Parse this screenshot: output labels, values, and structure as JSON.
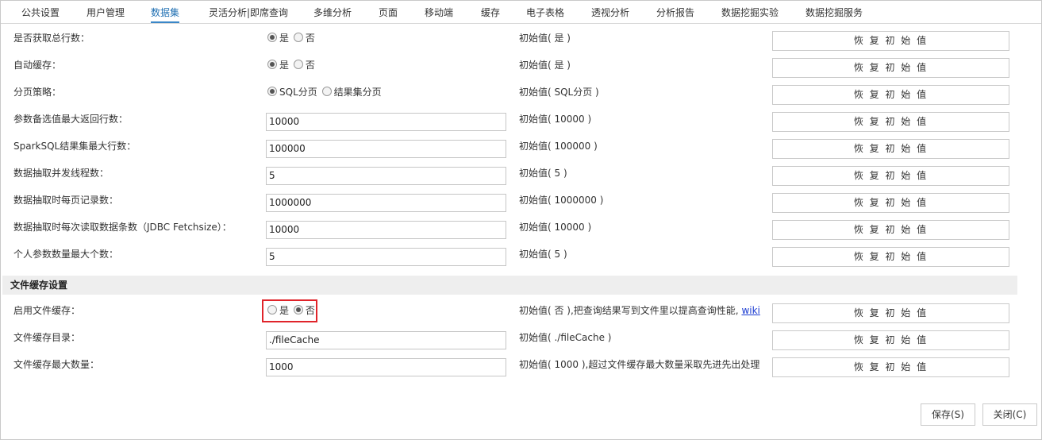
{
  "tabs": [
    {
      "label": "公共设置"
    },
    {
      "label": "用户管理"
    },
    {
      "label": "数据集"
    },
    {
      "label": "灵活分析|即席查询"
    },
    {
      "label": "多维分析"
    },
    {
      "label": "页面"
    },
    {
      "label": "移动端"
    },
    {
      "label": "缓存"
    },
    {
      "label": "电子表格"
    },
    {
      "label": "透视分析"
    },
    {
      "label": "分析报告"
    },
    {
      "label": "数据挖掘实验"
    },
    {
      "label": "数据挖掘服务"
    }
  ],
  "active_tab": "数据集",
  "reset_label": "恢 复 初 始 值",
  "radio": {
    "yes": "是",
    "no": "否",
    "sql_paging": "SQL分页",
    "resultset_paging": "结果集分页"
  },
  "rows": {
    "get_total_rows": {
      "label": "是否获取总行数：",
      "selected": "是",
      "initial": "初始值( 是 )"
    },
    "auto_cache": {
      "label": "自动缓存：",
      "selected": "是",
      "initial": "初始值( 是 )"
    },
    "paging_strategy": {
      "label": "分页策略：",
      "selected": "SQL分页",
      "initial": "初始值( SQL分页 )"
    },
    "param_max_rows": {
      "label": "参数备选值最大返回行数：",
      "value": "10000",
      "initial": "初始值( 10000 )"
    },
    "sparksql_max_rows": {
      "label": "SparkSQL结果集最大行数：",
      "value": "100000",
      "initial": "初始值( 100000 )"
    },
    "extract_threads": {
      "label": "数据抽取并发线程数：",
      "value": "5",
      "initial": "初始值( 5 )"
    },
    "extract_page_records": {
      "label": "数据抽取时每页记录数：",
      "value": "1000000",
      "initial": "初始值( 1000000 )"
    },
    "jdbc_fetchsize": {
      "label": "数据抽取时每次读取数据条数（JDBC Fetchsize）：",
      "value": "10000",
      "initial": "初始值( 10000 )"
    },
    "personal_param_max": {
      "label": "个人参数数量最大个数：",
      "value": "5",
      "initial": "初始值( 5 )"
    }
  },
  "file_cache_section": {
    "title": "文件缓存设置",
    "enable": {
      "label": "启用文件缓存：",
      "selected": "否",
      "initial": "初始值( 否 ),把查询结果写到文件里以提高查询性能,",
      "link": "wiki"
    },
    "directory": {
      "label": "文件缓存目录：",
      "value": "./fileCache",
      "initial": "初始值( ./fileCache )"
    },
    "max_count": {
      "label": "文件缓存最大数量：",
      "value": "1000",
      "initial": "初始值( 1000 ),超过文件缓存最大数量采取先进先出处理"
    }
  },
  "footer": {
    "save_label": "保存(S)",
    "close_label": "关闭(C)"
  },
  "colors": {
    "active_tab": "#1f6fb2",
    "highlight": "#e0242a",
    "link": "#1a3bd1",
    "section_bg": "#eeeeee"
  }
}
